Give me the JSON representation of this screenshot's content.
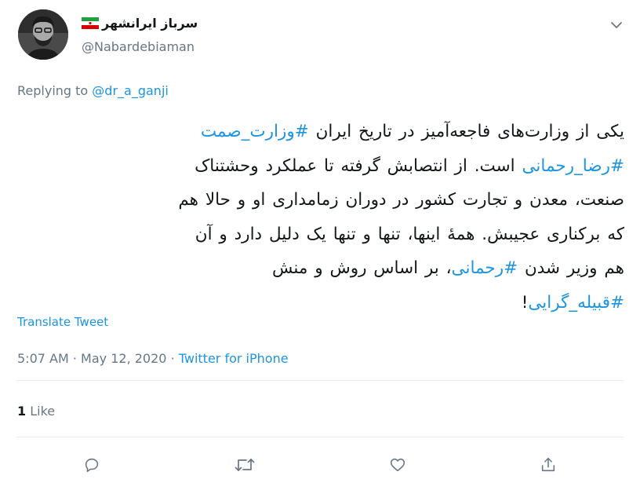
{
  "author": {
    "display_name": "سرباز ایرانشهر",
    "handle": "@Nabardebiaman"
  },
  "replying": {
    "prefix": "Replying to",
    "mention": "@dr_a_ganji"
  },
  "tweet": {
    "line1_text": "یکی از وزارت‌های فاجعه‌آمیز در تاریخ ایران",
    "line1_hashtag": "#وزارت_صمت",
    "line2_hashtag": "#رضا_رحمانی",
    "line2_text": "است. از انتصابش گرفته تا عملکرد وحشتناک",
    "line3_text": "صنعت، معدن و تجارت کشور در دوران زمامداری او و حالا هم",
    "line4_text": "که برکناری عجیبش. همهٔ اینها، تنها و تنها یک دلیل دارد و آن",
    "line5_text_a": "هم وزیر شدن",
    "line5_hashtag": "#رحمانی",
    "line5_text_b": "، بر اساس روش و منش",
    "line6_hashtag": "#قبیله_گرایی",
    "line6_text": "!"
  },
  "translate_label": "Translate Tweet",
  "meta": {
    "time": "5:07 AM",
    "separator": "·",
    "date": "May 12, 2020",
    "source": "Twitter for iPhone"
  },
  "likes": {
    "count": "1",
    "label": "Like"
  },
  "icons": {
    "reply": "reply-icon",
    "retweet": "retweet-icon",
    "like": "heart-icon",
    "share": "share-icon",
    "more": "chevron-down-icon",
    "flag": "iran-flag-icon"
  },
  "colors": {
    "link": "#1b95e0",
    "secondary": "#657786",
    "text": "#14171a",
    "divider": "#e6ecf0"
  }
}
